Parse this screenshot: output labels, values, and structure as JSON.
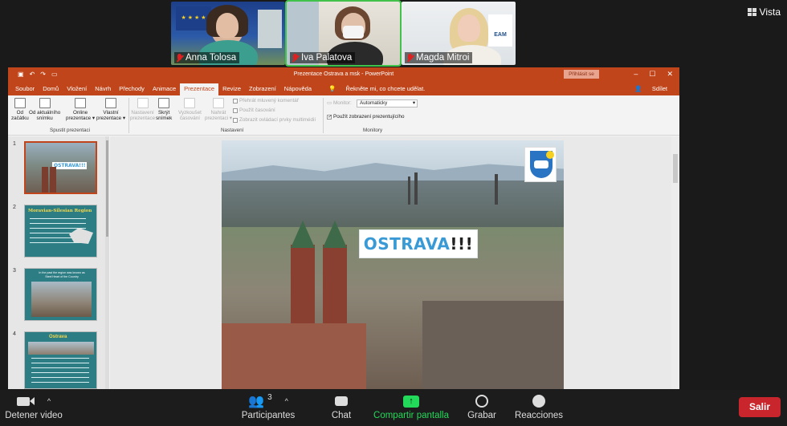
{
  "participants_videos": [
    {
      "name": "Anna Tolosa",
      "muted": true
    },
    {
      "name": "Iva Palatova",
      "muted": true
    },
    {
      "name": "Magda Mitroi",
      "muted": true
    }
  ],
  "view_button": {
    "label": "Vista",
    "icon": "grid-view-icon"
  },
  "powerpoint": {
    "window_title": "Prezentace Ostrava a msk  -  PowerPoint",
    "sign_in": "Přihlásit se",
    "tabs": [
      "Soubor",
      "Domů",
      "Vložení",
      "Návrh",
      "Přechody",
      "Animace",
      "Prezentace",
      "Revize",
      "Zobrazení",
      "Nápověda"
    ],
    "active_tab": "Prezentace",
    "tell_me": "Řekněte mi, co chcete udělat.",
    "share": "Sdílet",
    "ribbon": {
      "start_from_beginning": [
        "Od",
        "začátku"
      ],
      "from_current": [
        "Od aktuálního",
        "snímku"
      ],
      "online_presentation": [
        "Online",
        "prezentace ▾"
      ],
      "custom_show": [
        "Vlastní",
        "prezentace ▾"
      ],
      "group_start": "Spustit prezentaci",
      "setup": [
        "Nastavení",
        "prezentace"
      ],
      "hide_slide": [
        "Skrýt",
        "snímek"
      ],
      "rehearse": [
        "Vyzkoušet",
        "časování"
      ],
      "record": [
        "Nahrát",
        "prezentaci ▾"
      ],
      "play_narrations": "Přehrát mluvený komentář",
      "use_timings": "Použít časování",
      "show_media_controls": "Zobrazit ovládací prvky multimédií",
      "group_setup": "Nastavení",
      "monitor_label": "Monitor:",
      "monitor_value": "Automaticky",
      "presenter_view": "Použít zobrazení prezentujícího",
      "group_monitors": "Monitory"
    },
    "thumbnails": [
      {
        "number": "1",
        "title": "OSTRAVA!!!"
      },
      {
        "number": "2",
        "title": "Moravian-Silesian Region"
      },
      {
        "number": "3",
        "title": "In the past the region was known as Steel Heart of the Country"
      },
      {
        "number": "4",
        "title": "Ostrava"
      }
    ],
    "slide": {
      "title": "OSTRAVA",
      "exclaim": "!!!"
    }
  },
  "bottom_bar": {
    "stop_video": "Detener video",
    "participants": "Participantes",
    "participants_count": "3",
    "chat": "Chat",
    "share_screen": "Compartir pantalla",
    "record": "Grabar",
    "reactions": "Reacciones",
    "leave": "Salir"
  },
  "colors": {
    "accent_ppt": "#c0451a",
    "share_green": "#23d959",
    "leave_red": "#c8262c",
    "title_blue": "#3a9ad6"
  }
}
